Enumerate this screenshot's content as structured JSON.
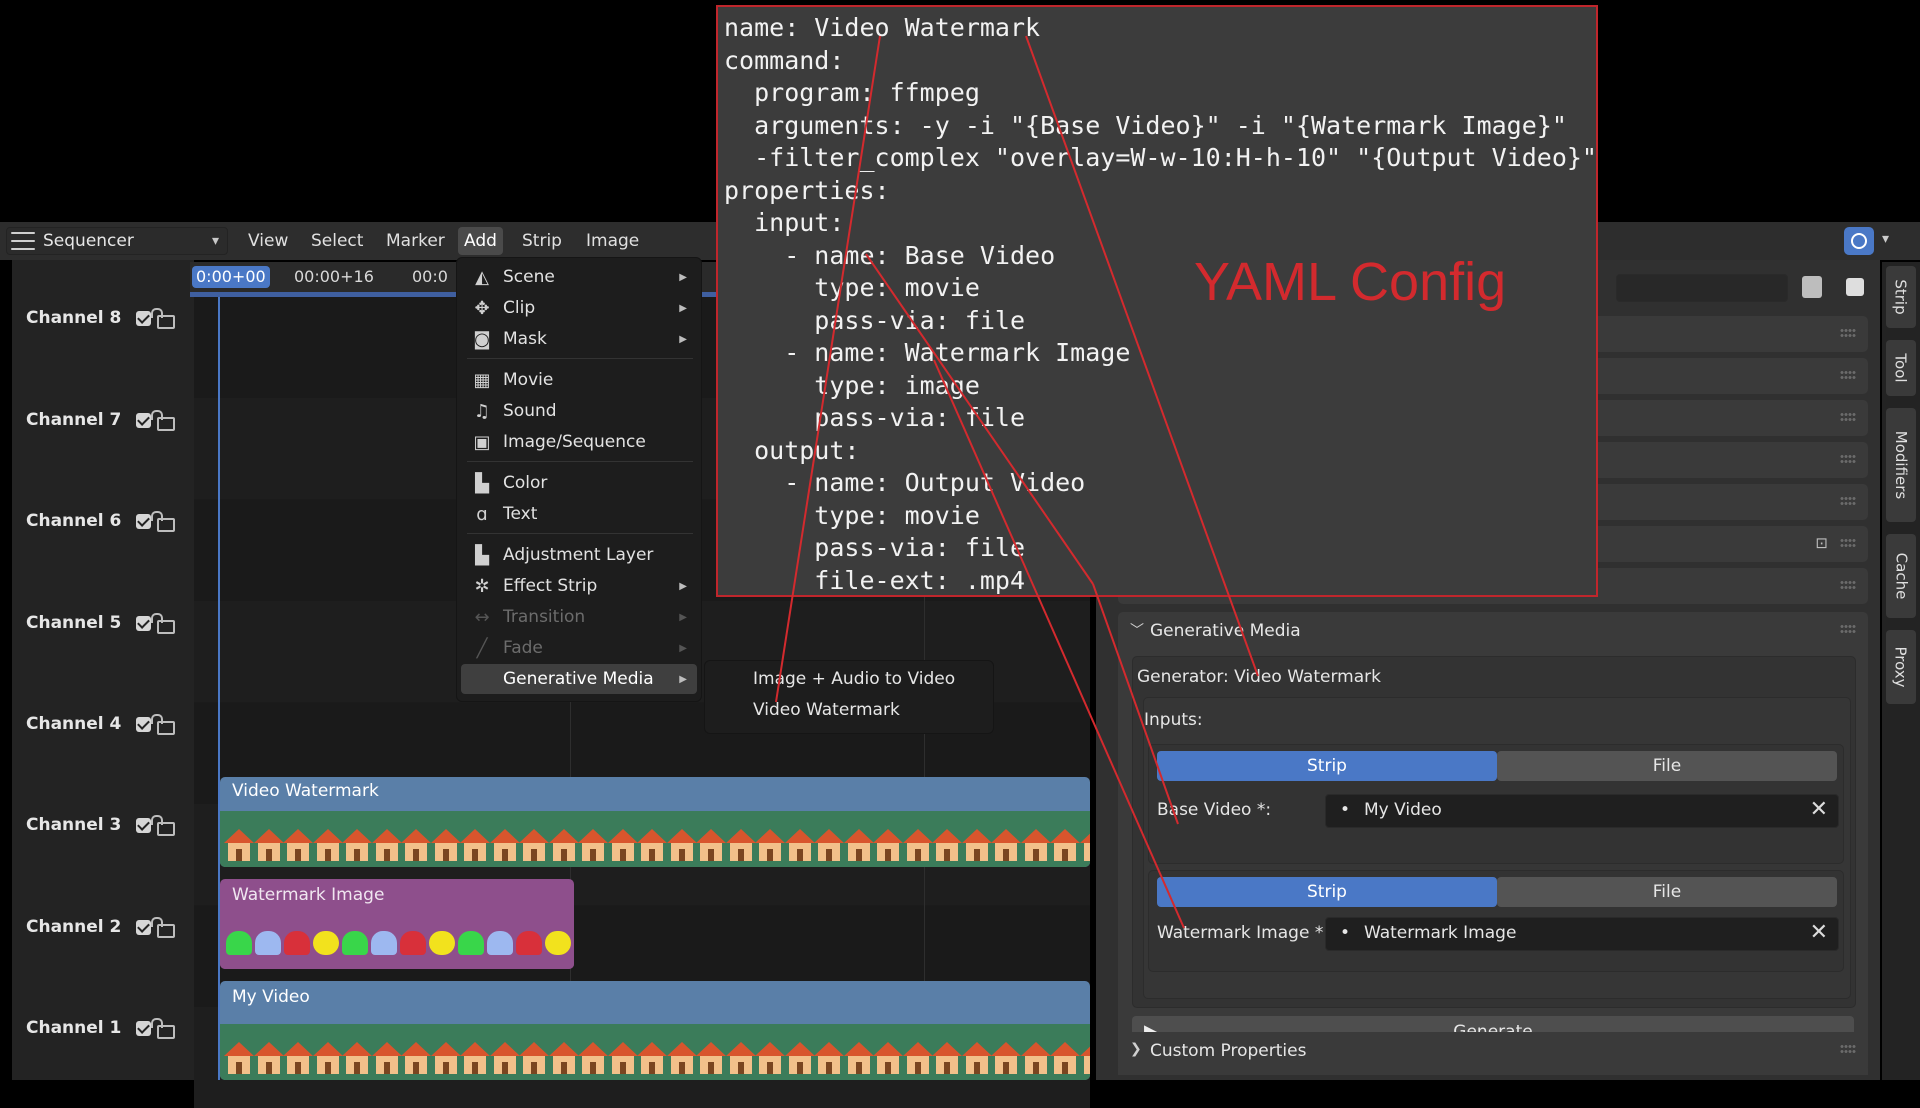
{
  "header": {
    "editor_type": "Sequencer",
    "menus": [
      "View",
      "Select",
      "Marker",
      "Add",
      "Strip",
      "Image"
    ]
  },
  "ruler": {
    "current": "0:00+00",
    "ticks": [
      "00:00+16",
      "00:0"
    ]
  },
  "channels": [
    "Channel 8",
    "Channel 7",
    "Channel 6",
    "Channel 5",
    "Channel 4",
    "Channel 3",
    "Channel 2",
    "Channel 1"
  ],
  "strips": {
    "video_watermark": "Video Watermark",
    "watermark_image": "Watermark Image",
    "my_video": "My Video"
  },
  "add_menu": {
    "items": [
      {
        "label": "Scene",
        "submenu": true
      },
      {
        "label": "Clip",
        "submenu": true
      },
      {
        "label": "Mask",
        "submenu": true
      },
      {
        "label": "Movie",
        "submenu": false
      },
      {
        "label": "Sound",
        "submenu": false
      },
      {
        "label": "Image/Sequence",
        "submenu": false
      },
      {
        "label": "Color",
        "submenu": false
      },
      {
        "label": "Text",
        "submenu": false
      },
      {
        "label": "Adjustment Layer",
        "submenu": false
      },
      {
        "label": "Effect Strip",
        "submenu": true
      },
      {
        "label": "Transition",
        "submenu": true,
        "disabled": true
      },
      {
        "label": "Fade",
        "submenu": true,
        "disabled": true
      },
      {
        "label": "Generative Media",
        "submenu": true,
        "highlighted": true
      }
    ],
    "submenu_items": [
      "Image + Audio to Video",
      "Video Watermark"
    ]
  },
  "properties": {
    "panel_title": "Generative Media",
    "generator_line": "Generator: Video Watermark",
    "inputs_label": "Inputs:",
    "seg_strip": "Strip",
    "seg_file": "File",
    "base_video_label": "Base Video *:",
    "base_video_value": "My Video",
    "watermark_label": "Watermark Image *:",
    "watermark_value": "Watermark Image",
    "generate_label": "Generate",
    "custom_props": "Custom Properties",
    "clear_symbol": "✕",
    "bullet": "•"
  },
  "vertical_tabs": [
    "Strip",
    "Tool",
    "Modifiers",
    "Cache",
    "Proxy"
  ],
  "yaml_overlay": {
    "label": "YAML Config",
    "lines": [
      "name: Video Watermark",
      "command:",
      "  program: ffmpeg",
      "  arguments: -y -i \"{Base Video}\" -i \"{Watermark Image}\"",
      "  -filter_complex \"overlay=W-w-10:H-h-10\" \"{Output Video}\"",
      "properties:",
      "  input:",
      "    - name: Base Video",
      "      type: movie",
      "      pass-via: file",
      "    - name: Watermark Image",
      "      type: image",
      "      pass-via: file",
      "  output:",
      "    - name: Output Video",
      "      type: movie",
      "      pass-via: file",
      "      file-ext: .mp4"
    ]
  },
  "colors": {
    "accent": "#4a78c6",
    "annotation_red": "#d32a2e",
    "strip_movie": "#5a7fa8",
    "strip_image": "#8e4f8c"
  }
}
